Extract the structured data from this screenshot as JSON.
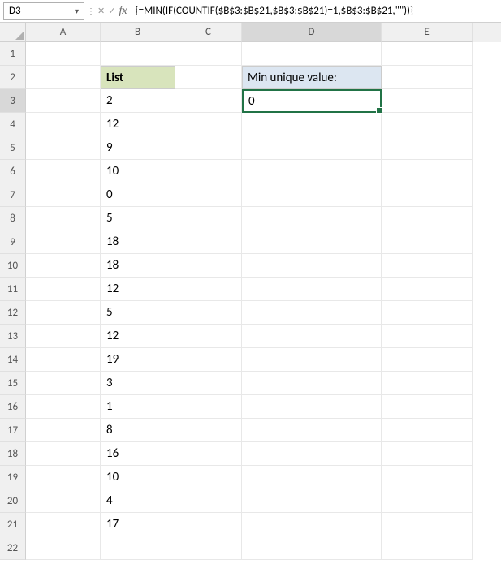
{
  "nameBox": {
    "cellRef": "D3"
  },
  "formulaBar": {
    "formula": "{=MIN(IF(COUNTIF($B$3:$B$21,$B$3:$B$21)=1,$B$3:$B$21,\"\"))}"
  },
  "columns": [
    "A",
    "B",
    "C",
    "D",
    "E"
  ],
  "rows": [
    "1",
    "2",
    "3",
    "4",
    "5",
    "6",
    "7",
    "8",
    "9",
    "10",
    "11",
    "12",
    "13",
    "14",
    "15",
    "16",
    "17",
    "18",
    "19",
    "20",
    "21",
    "22"
  ],
  "selectedCell": "D3",
  "headers": {
    "listHeader": "List",
    "outputHeader": "Min unique value:"
  },
  "listData": [
    "2",
    "12",
    "9",
    "10",
    "0",
    "5",
    "18",
    "18",
    "12",
    "5",
    "12",
    "19",
    "3",
    "1",
    "8",
    "16",
    "10",
    "4",
    "17"
  ],
  "outputValue": "0",
  "chart_data": {
    "type": "table",
    "title": "Min unique value",
    "columns": [
      "List"
    ],
    "values": [
      2,
      12,
      9,
      10,
      0,
      5,
      18,
      18,
      12,
      5,
      12,
      19,
      3,
      1,
      8,
      16,
      10,
      4,
      17
    ],
    "result_label": "Min unique value:",
    "result": 0
  }
}
